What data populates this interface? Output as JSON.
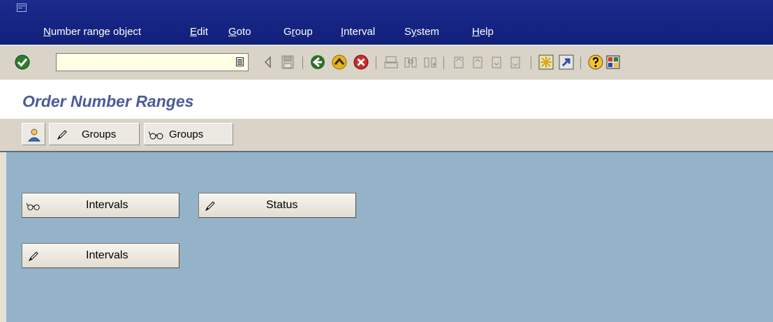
{
  "menu": {
    "items": [
      {
        "label": "Number range object",
        "underline": "N"
      },
      {
        "label": "Edit",
        "underline": "E"
      },
      {
        "label": "Goto",
        "underline": "G"
      },
      {
        "label": "Group",
        "underline": "r"
      },
      {
        "label": "Interval",
        "underline": "I"
      },
      {
        "label": "System",
        "underline": "y"
      },
      {
        "label": "Help",
        "underline": "H"
      }
    ]
  },
  "toolbar": {
    "command_value": "",
    "icons": [
      "enter-icon",
      "command-history-icon",
      "back-arrow-icon",
      "save-icon",
      "green-back-icon",
      "exit-icon",
      "cancel-icon",
      "print-icon",
      "find-icon",
      "find-next-icon",
      "first-page-icon",
      "prev-page-icon",
      "next-page-icon",
      "last-page-icon",
      "new-session-icon",
      "shortcut-icon",
      "help-icon",
      "layout-icon"
    ]
  },
  "title": {
    "text": "Order Number Ranges"
  },
  "app_toolbar": {
    "buttons": [
      {
        "label": "",
        "icon": "person-icon"
      },
      {
        "label": "Groups",
        "icon": "pencil-icon"
      },
      {
        "label": "Groups",
        "icon": "glasses-icon"
      }
    ]
  },
  "main": {
    "buttons": [
      {
        "label": "Intervals",
        "icon": "glasses-icon"
      },
      {
        "label": "Status",
        "icon": "pencil-icon"
      },
      {
        "label": "Intervals",
        "icon": "pencil-icon"
      }
    ]
  }
}
